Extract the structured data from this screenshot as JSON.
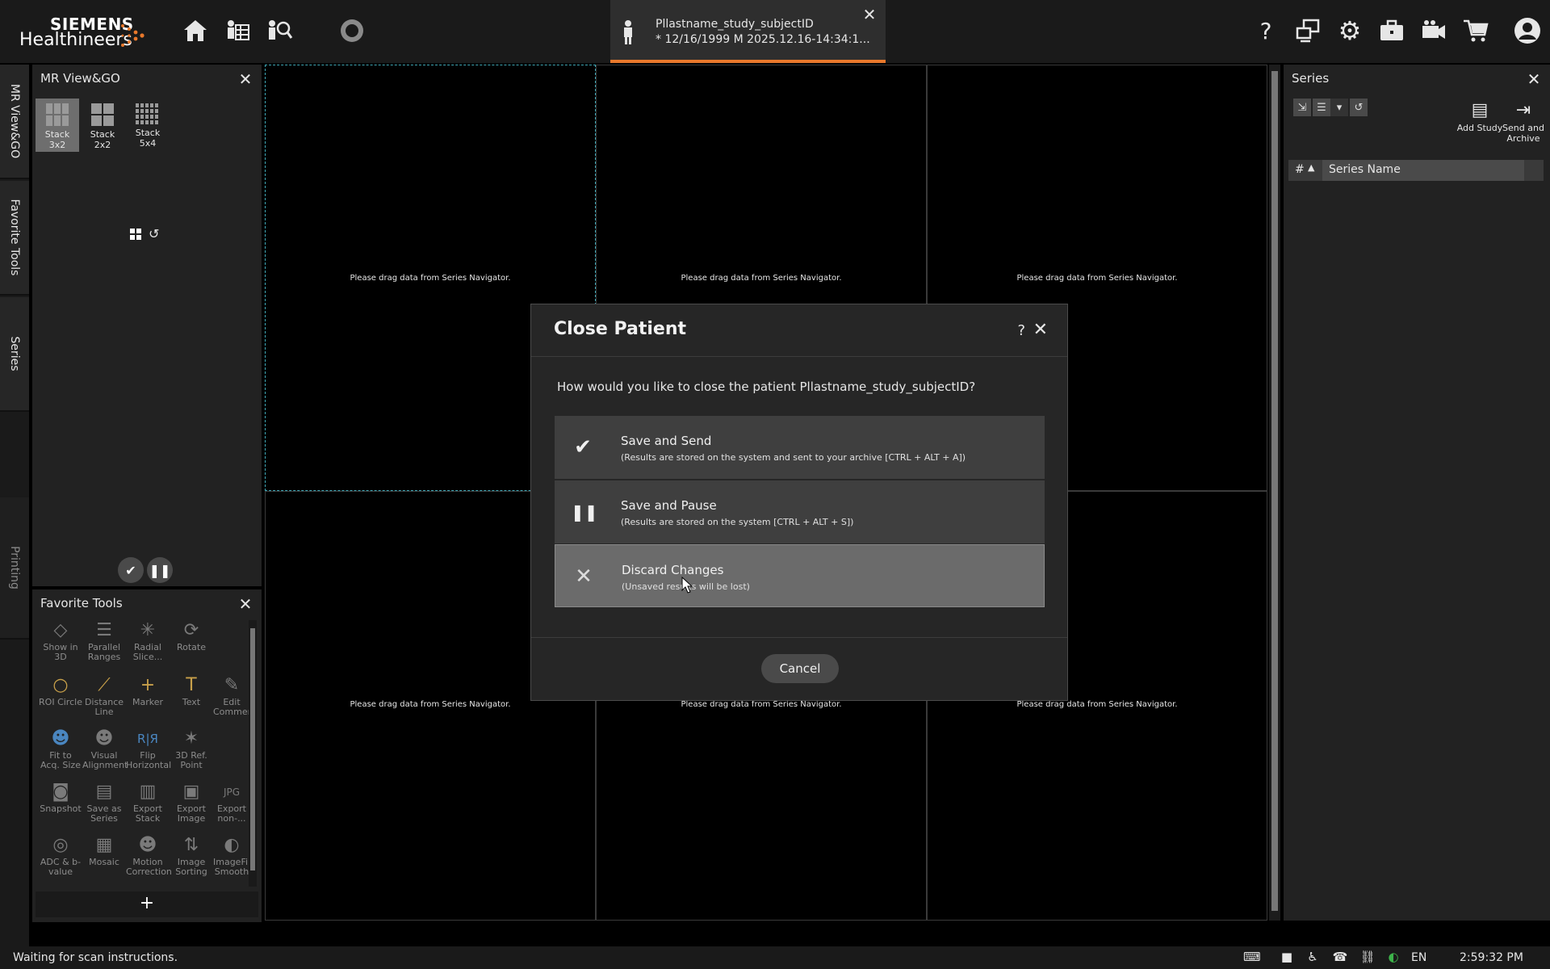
{
  "brand": {
    "line1": "SIEMENS",
    "line2": "Healthineers"
  },
  "patient_tab": {
    "name": "Pllastname_study_subjectID",
    "details": "* 12/16/1999 M 2025.12.16-14:34:1..."
  },
  "vertical_tabs": [
    "MR View&GO",
    "Favorite Tools",
    "Series",
    "Printing"
  ],
  "view_go": {
    "title": "MR View&GO",
    "layouts": [
      "Stack 3x2",
      "Stack 2x2",
      "Stack 5x4"
    ],
    "selected_layout": "Stack 3x2"
  },
  "favorite_tools": {
    "title": "Favorite Tools",
    "items": [
      "Show in 3D",
      "Parallel Ranges",
      "Radial Slice...",
      "Rotate",
      "ROI Circle",
      "Distance Line",
      "Marker",
      "Text",
      "Edit Commer",
      "Fit to Acq. Size",
      "Visual Alignment",
      "Flip Horizontal",
      "3D Ref. Point",
      "Snapshot",
      "Save as Series",
      "Export Stack",
      "Export Image",
      "Export non-...",
      "ADC & b-value",
      "Mosaic",
      "Motion Correction",
      "Image Sorting",
      "ImageFil Smooth"
    ],
    "add_label": "+"
  },
  "viewer": {
    "placeholder": "Please drag data from Series Navigator."
  },
  "series_panel": {
    "title": "Series",
    "add_study": "Add Study",
    "send_archive": "Send and Archive",
    "col_number": "#",
    "col_name": "Series Name"
  },
  "dialog": {
    "title": "Close Patient",
    "question": "How would you like to close the patient Pllastname_study_subjectID?",
    "options": [
      {
        "label": "Save and Send",
        "desc": "(Results are stored on the system and sent to your archive [CTRL + ALT + A])",
        "icon": "check-icon"
      },
      {
        "label": "Save and Pause",
        "desc": "(Results are stored on the system [CTRL + ALT + S])",
        "icon": "pause-icon"
      },
      {
        "label": "Discard Changes",
        "desc": "(Unsaved results will be lost)",
        "icon": "x-icon"
      }
    ],
    "cancel": "Cancel"
  },
  "status": {
    "text": "Waiting for scan instructions.",
    "language": "EN",
    "clock": "2:59:32 PM"
  },
  "colors": {
    "accent_tab": "#e8782b",
    "active_viewport": "#3fa7b5"
  }
}
